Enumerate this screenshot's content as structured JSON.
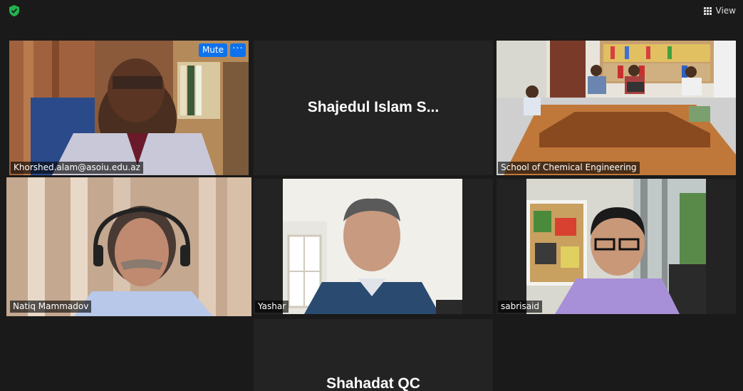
{
  "topbar": {
    "security_icon": "shield-check-icon",
    "view_icon": "grid-icon",
    "view_label": "View"
  },
  "participants": [
    {
      "name": "Khorshed.alam@asoiu.edu.az",
      "video": true,
      "mute_label": "Mute",
      "more_label": "···"
    },
    {
      "name": "Shajedul Islam S...",
      "video": false
    },
    {
      "name": "School of Chemical Engineering",
      "video": true
    },
    {
      "name": "Natiq Mammadov",
      "video": true,
      "active_speaker": true
    },
    {
      "name": "Yashar",
      "video": true
    },
    {
      "name": "sabrisaid",
      "video": true
    },
    {
      "name": "Shahadat QC",
      "video": false
    }
  ],
  "colors": {
    "background": "#1a1a1a",
    "tile": "#232323",
    "active_speaker_border": "#c9e85a",
    "button_blue": "#0e72ed",
    "security_green": "#23b14d"
  }
}
